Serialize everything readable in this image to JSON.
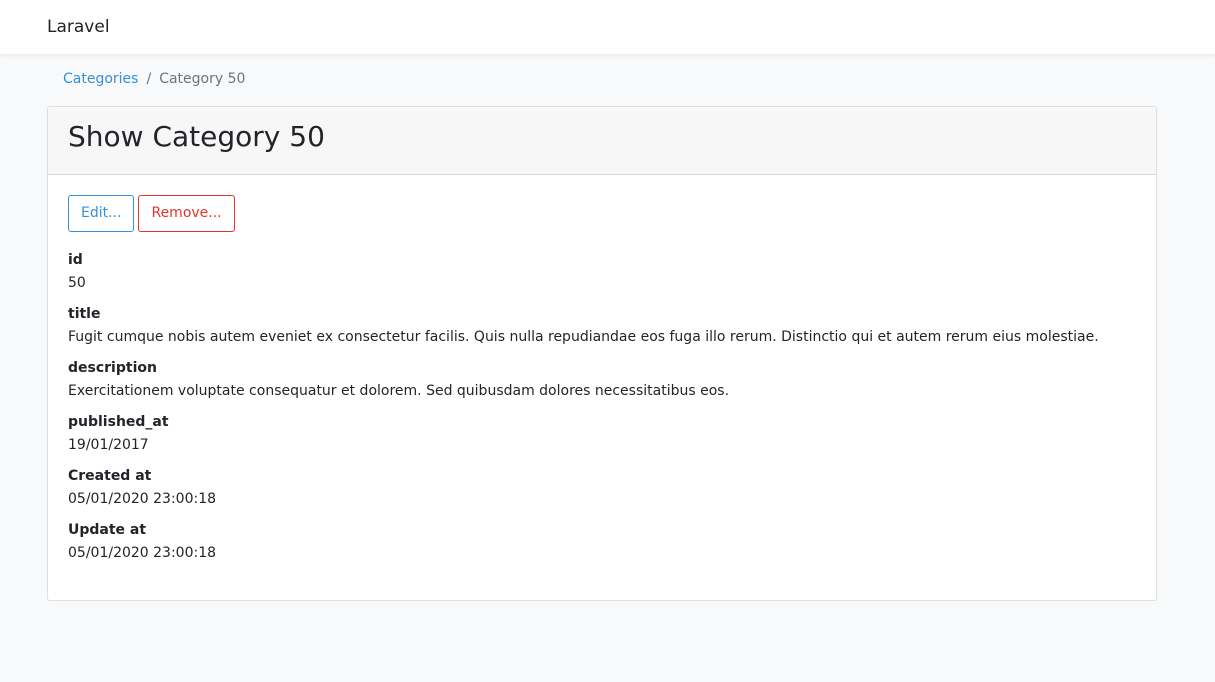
{
  "navbar": {
    "brand": "Laravel"
  },
  "breadcrumb": {
    "parent": "Categories",
    "separator": "/",
    "current": "Category 50"
  },
  "card": {
    "title": "Show Category 50",
    "buttons": {
      "edit": "Edit...",
      "remove": "Remove..."
    },
    "fields": [
      {
        "label": "id",
        "value": "50"
      },
      {
        "label": "title",
        "value": "Fugit cumque nobis autem eveniet ex consectetur facilis. Quis nulla repudiandae eos fuga illo rerum. Distinctio qui et autem rerum eius molestiae."
      },
      {
        "label": "description",
        "value": "Exercitationem voluptate consequatur et dolorem. Sed quibusdam dolores necessitatibus eos."
      },
      {
        "label": "published_at",
        "value": "19/01/2017"
      },
      {
        "label": "Created at",
        "value": "05/01/2020 23:00:18"
      },
      {
        "label": "Update at",
        "value": "05/01/2020 23:00:18"
      }
    ]
  },
  "colors": {
    "primary": "#3490dc",
    "danger": "#e3342f",
    "background": "#f8f9fa",
    "muted": "#6c757d"
  }
}
